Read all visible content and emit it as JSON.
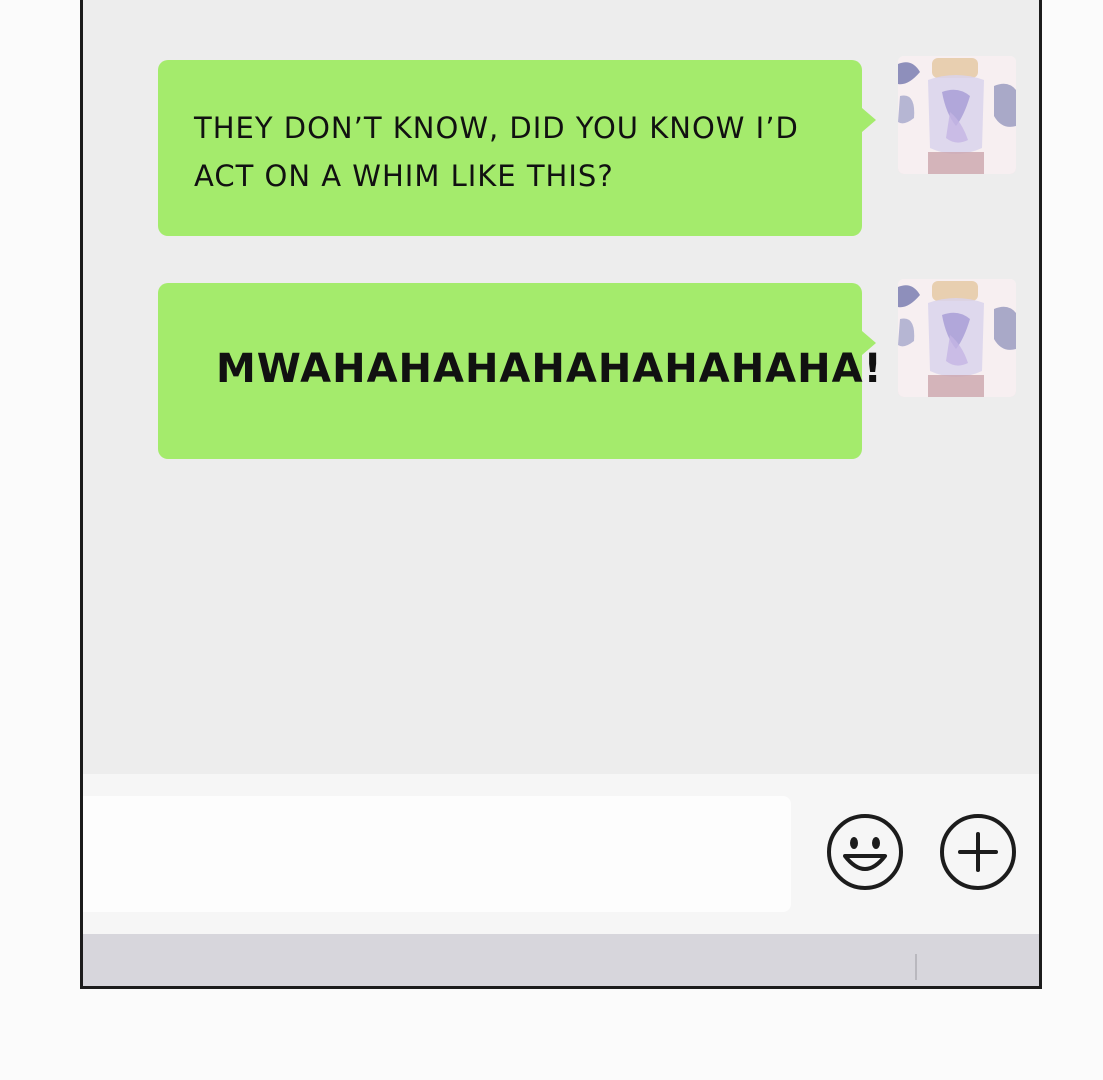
{
  "chat": {
    "messages": [
      {
        "text": "THEY DON’T KNOW, DID YOU KNOW I’D ACT ON A WHIM LIKE THIS?",
        "line1": "THEY DON’T KNOW, DID YOU KNOW I’D",
        "line2": "ACT ON A WHIM LIKE THIS?",
        "sender": "self"
      },
      {
        "text": "MWAHAHAHAHAHAHAHAHA!",
        "sender": "self"
      }
    ]
  },
  "input_bar": {
    "value": "",
    "placeholder": ""
  },
  "icons": {
    "emoji": "smiley-face-icon",
    "plus": "plus-circle-icon"
  },
  "colors": {
    "bubble": "#a4eb6c",
    "chat_background": "#ededed",
    "frame_border": "#1c1c1c",
    "bottom_strip": "#d7d6dc"
  }
}
